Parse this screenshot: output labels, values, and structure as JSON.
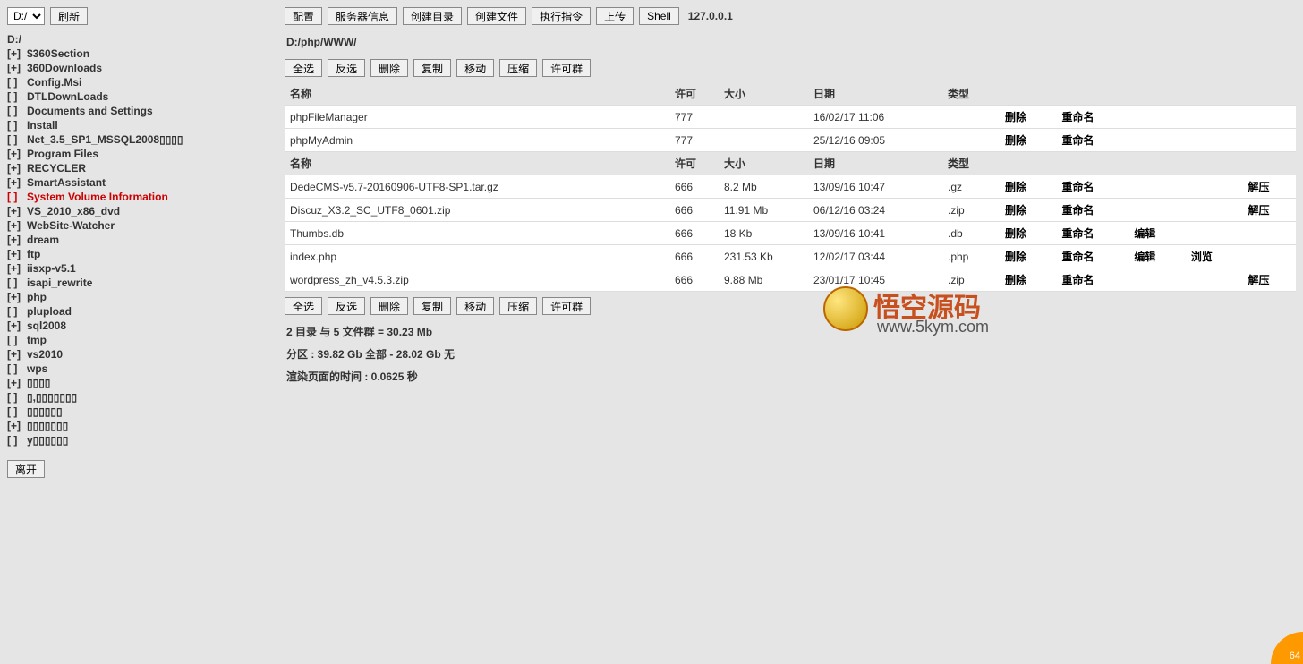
{
  "sidebar": {
    "drive_options": [
      "D:/"
    ],
    "refresh_label": "刷新",
    "root_label": "D:/",
    "tree": [
      {
        "badge": "[+]",
        "label": "$360Section",
        "highlight": false
      },
      {
        "badge": "[+]",
        "label": "360Downloads",
        "highlight": false
      },
      {
        "badge": "[ ]",
        "label": "Config.Msi",
        "highlight": false
      },
      {
        "badge": "[ ]",
        "label": "DTLDownLoads",
        "highlight": false
      },
      {
        "badge": "[ ]",
        "label": "Documents and Settings",
        "highlight": false
      },
      {
        "badge": "[ ]",
        "label": "Install",
        "highlight": false
      },
      {
        "badge": "[ ]",
        "label": "Net_3.5_SP1_MSSQL2008▯▯▯▯",
        "highlight": false
      },
      {
        "badge": "[+]",
        "label": "Program Files",
        "highlight": false
      },
      {
        "badge": "[+]",
        "label": "RECYCLER",
        "highlight": false
      },
      {
        "badge": "[+]",
        "label": "SmartAssistant",
        "highlight": false
      },
      {
        "badge": "[ ]",
        "label": "System Volume Information",
        "highlight": true
      },
      {
        "badge": "[+]",
        "label": "VS_2010_x86_dvd",
        "highlight": false
      },
      {
        "badge": "[+]",
        "label": "WebSite-Watcher",
        "highlight": false
      },
      {
        "badge": "[+]",
        "label": "dream",
        "highlight": false
      },
      {
        "badge": "[+]",
        "label": "ftp",
        "highlight": false
      },
      {
        "badge": "[+]",
        "label": "iisxp-v5.1",
        "highlight": false
      },
      {
        "badge": "[ ]",
        "label": "isapi_rewrite",
        "highlight": false
      },
      {
        "badge": "[+]",
        "label": "php",
        "highlight": false
      },
      {
        "badge": "[ ]",
        "label": "plupload",
        "highlight": false
      },
      {
        "badge": "[+]",
        "label": "sql2008",
        "highlight": false
      },
      {
        "badge": "[ ]",
        "label": "tmp",
        "highlight": false
      },
      {
        "badge": "[+]",
        "label": "vs2010",
        "highlight": false
      },
      {
        "badge": "[ ]",
        "label": "wps",
        "highlight": false
      },
      {
        "badge": "[+]",
        "label": "▯▯▯▯",
        "highlight": false
      },
      {
        "badge": "[ ]",
        "label": "▯,▯▯▯▯▯▯▯",
        "highlight": false
      },
      {
        "badge": "[ ]",
        "label": "▯▯▯▯▯▯",
        "highlight": false
      },
      {
        "badge": "[+]",
        "label": "▯▯▯▯▯▯▯",
        "highlight": false
      },
      {
        "badge": "[ ]",
        "label": "y▯▯▯▯▯▯",
        "highlight": false
      }
    ],
    "leave_label": "离开"
  },
  "toolbar": {
    "config": "配置",
    "server_info": "服务器信息",
    "mkdir": "创建目录",
    "mkfile": "创建文件",
    "exec": "执行指令",
    "upload": "上传",
    "shell": "Shell",
    "ip": "127.0.0.1"
  },
  "path": "D:/php/WWW/",
  "toolbar2": {
    "select_all": "全选",
    "invert": "反选",
    "delete": "删除",
    "copy": "复制",
    "move": "移动",
    "compress": "压缩",
    "permgroup": "许可群"
  },
  "headers": {
    "name": "名称",
    "perm": "许可",
    "size": "大小",
    "date": "日期",
    "type": "类型"
  },
  "actions": {
    "delete": "删除",
    "rename": "重命名",
    "edit": "编辑",
    "view": "浏览",
    "extract": "解压"
  },
  "dirs": [
    {
      "name": "phpFileManager",
      "perm": "777",
      "size": "",
      "date": "16/02/17 11:06",
      "type": "",
      "actions": [
        "delete",
        "rename"
      ]
    },
    {
      "name": "phpMyAdmin",
      "perm": "777",
      "size": "",
      "date": "25/12/16 09:05",
      "type": "",
      "actions": [
        "delete",
        "rename"
      ]
    }
  ],
  "files": [
    {
      "name": "DedeCMS-v5.7-20160906-UTF8-SP1.tar.gz",
      "perm": "666",
      "size": "8.2 Mb",
      "date": "13/09/16 10:47",
      "type": ".gz",
      "actions": [
        "delete",
        "rename",
        "",
        "",
        "extract"
      ]
    },
    {
      "name": "Discuz_X3.2_SC_UTF8_0601.zip",
      "perm": "666",
      "size": "11.91 Mb",
      "date": "06/12/16 03:24",
      "type": ".zip",
      "actions": [
        "delete",
        "rename",
        "",
        "",
        "extract"
      ]
    },
    {
      "name": "Thumbs.db",
      "perm": "666",
      "size": "18 Kb",
      "date": "13/09/16 10:41",
      "type": ".db",
      "actions": [
        "delete",
        "rename",
        "edit"
      ]
    },
    {
      "name": "index.php",
      "perm": "666",
      "size": "231.53 Kb",
      "date": "12/02/17 03:44",
      "type": ".php",
      "actions": [
        "delete",
        "rename",
        "edit",
        "view"
      ]
    },
    {
      "name": "wordpress_zh_v4.5.3.zip",
      "perm": "666",
      "size": "9.88 Mb",
      "date": "23/01/17 10:45",
      "type": ".zip",
      "actions": [
        "delete",
        "rename",
        "",
        "",
        "extract"
      ]
    }
  ],
  "summary": {
    "count": "2 目录 与 5 文件群 = 30.23 Mb",
    "partition": "分区 : 39.82 Gb 全部 - 28.02 Gb 无",
    "render": "渲染页面的时间 : 0.0625 秒"
  },
  "watermark": {
    "brand": "悟空源码",
    "url": "www.5kym.com"
  },
  "badge": "64"
}
